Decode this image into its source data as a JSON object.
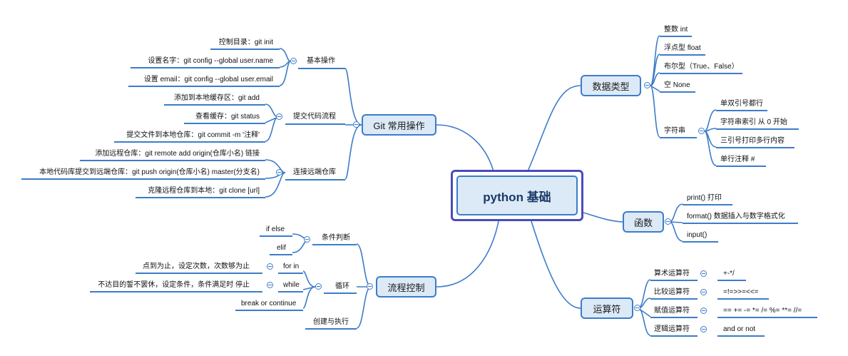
{
  "root": "python 基础",
  "git": {
    "title": "Git 常用操作",
    "basic": {
      "label": "基本操作",
      "items": [
        "控制目录：git init",
        "设置名字：git config --global user.name",
        "设置 email：git config --global user.email"
      ]
    },
    "commit": {
      "label": "提交代码流程",
      "items": [
        "添加到本地缓存区：git add",
        "查看缓存：git status",
        "提交文件到本地仓库：git commit -m '注释'"
      ]
    },
    "remote": {
      "label": "连接远端仓库",
      "items": [
        "添加远程仓库：git remote add origin(仓库小名) 链接",
        "本地代码库提交到远端仓库：git push origin(仓库小名) master(分支名)",
        "克隆远程仓库到本地：git clone [url]"
      ]
    }
  },
  "flow": {
    "title": "流程控制",
    "cond": {
      "label": "条件判断",
      "items": [
        "if else",
        "elif"
      ]
    },
    "loop": {
      "label": "循环",
      "forin": "for in",
      "forin_note": "点到为止，设定次数，次数够为止",
      "while": "while",
      "while_note": "不达目的誓不罢休，设定条件，条件满足时 停止",
      "break": "break or continue"
    },
    "create": "创建与执行"
  },
  "types": {
    "title": "数据类型",
    "items": [
      "整数 int",
      "浮点型 float",
      "布尔型（True、False）",
      "空 None"
    ],
    "str": {
      "label": "字符串",
      "items": [
        "单双引号都行",
        "字符串索引 从 0 开始",
        "三引号打印多行内容",
        "单行注释 #"
      ]
    }
  },
  "func": {
    "title": "函数",
    "items": [
      "print() 打印",
      "format() 数据插入与数字格式化",
      "input()"
    ]
  },
  "ops": {
    "title": "运算符",
    "rows": [
      {
        "label": "算术运算符",
        "value": "+-*/"
      },
      {
        "label": "比较运算符",
        "value": "=!=>>=<<="
      },
      {
        "label": "赋值运算符",
        "value": "== += -= *= /= %= **= //="
      },
      {
        "label": "逻辑运算符",
        "value": "and or not"
      }
    ]
  },
  "colors": {
    "line": "#3d7cc9",
    "box_fill": "#dce9f7",
    "root_border": "#4c4bb8"
  }
}
